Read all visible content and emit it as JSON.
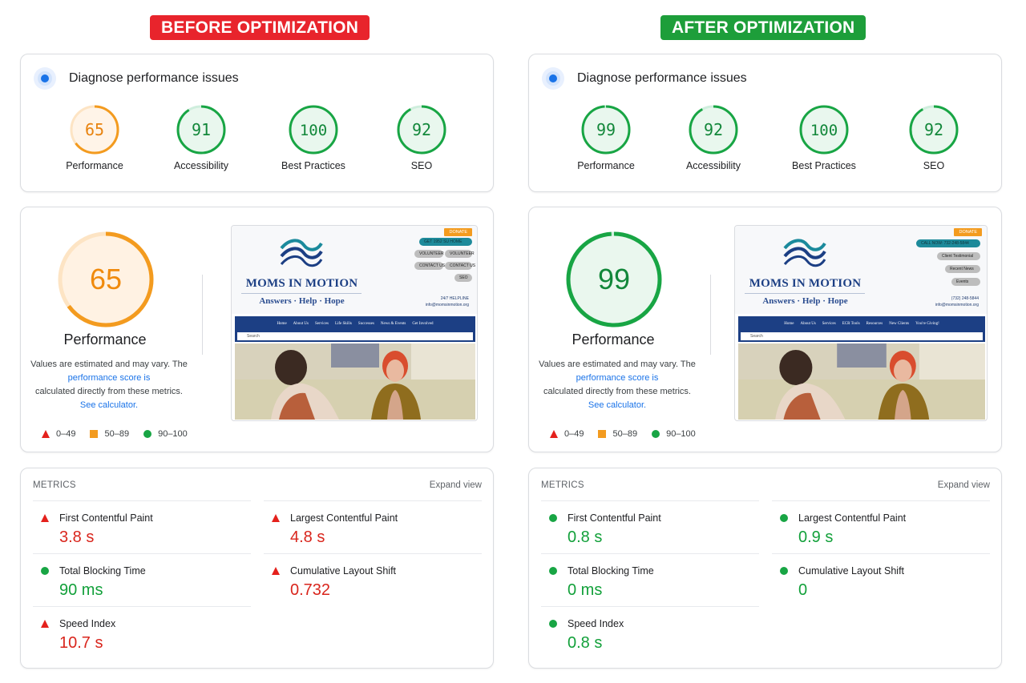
{
  "colors": {
    "fail": "#e4211c",
    "average": "#f39b1f",
    "pass": "#18a544",
    "link": "#1a73e8",
    "before_badge": "#e8242c",
    "after_badge": "#1d9e3a"
  },
  "before": {
    "badge": "BEFORE OPTIMIZATION",
    "diagnose_title": "Diagnose performance issues",
    "scores": [
      {
        "label": "Performance",
        "value": "65",
        "rating": "average"
      },
      {
        "label": "Accessibility",
        "value": "91",
        "rating": "pass"
      },
      {
        "label": "Best Practices",
        "value": "100",
        "rating": "pass"
      },
      {
        "label": "SEO",
        "value": "92",
        "rating": "pass"
      }
    ],
    "perf_score": "65",
    "perf_title": "Performance",
    "perf_desc_1": "Values are estimated and may vary. The",
    "perf_desc_link": "performance score is",
    "perf_desc_2": "calculated directly from these metrics.",
    "perf_calc_link": "See calculator.",
    "legend": [
      "0–49",
      "50–89",
      "90–100"
    ],
    "metrics_label": "METRICS",
    "expand_label": "Expand view",
    "metrics": [
      {
        "name": "First Contentful Paint",
        "value": "3.8 s",
        "rating": "fail"
      },
      {
        "name": "Total Blocking Time",
        "value": "90 ms",
        "rating": "pass"
      },
      {
        "name": "Speed Index",
        "value": "10.7 s",
        "rating": "fail"
      },
      {
        "name": "Largest Contentful Paint",
        "value": "4.8 s",
        "rating": "fail"
      },
      {
        "name": "Cumulative Layout Shift",
        "value": "0.732",
        "rating": "fail"
      }
    ],
    "site": {
      "logo": "MOMS IN MOTION",
      "tagline": "Answers · Help · Hope",
      "donate": "DONATE",
      "pills": [
        "GET 1952 SU HOME",
        "VOLUNTEER",
        "VOLUNTEER",
        "CONTACT US",
        "CONTACT US",
        "SEO"
      ],
      "phone": "24/7 HELPLINE",
      "email": "info@momsinmotion.org",
      "nav": [
        "Home",
        "About Us",
        "Services",
        "Life Skills",
        "Successes",
        "News & Events",
        "Get Involved"
      ],
      "search": "Search"
    }
  },
  "after": {
    "badge": "AFTER OPTIMIZATION",
    "diagnose_title": "Diagnose performance issues",
    "scores": [
      {
        "label": "Performance",
        "value": "99",
        "rating": "pass"
      },
      {
        "label": "Accessibility",
        "value": "92",
        "rating": "pass"
      },
      {
        "label": "Best Practices",
        "value": "100",
        "rating": "pass"
      },
      {
        "label": "SEO",
        "value": "92",
        "rating": "pass"
      }
    ],
    "perf_score": "99",
    "perf_title": "Performance",
    "perf_desc_1": "Values are estimated and may vary. The",
    "perf_desc_link": "performance score is",
    "perf_desc_2": "calculated directly from these metrics.",
    "perf_calc_link": "See calculator.",
    "legend": [
      "0–49",
      "50–89",
      "90–100"
    ],
    "metrics_label": "METRICS",
    "expand_label": "Expand view",
    "metrics": [
      {
        "name": "First Contentful Paint",
        "value": "0.8 s",
        "rating": "pass"
      },
      {
        "name": "Total Blocking Time",
        "value": "0 ms",
        "rating": "pass"
      },
      {
        "name": "Speed Index",
        "value": "0.8 s",
        "rating": "pass"
      },
      {
        "name": "Largest Contentful Paint",
        "value": "0.9 s",
        "rating": "pass"
      },
      {
        "name": "Cumulative Layout Shift",
        "value": "0",
        "rating": "pass"
      }
    ],
    "site": {
      "logo": "MOMS IN MOTION",
      "tagline": "Answers · Help · Hope",
      "donate": "DONATE",
      "pills": [
        "CALL NOW: 732-248-5844",
        "Client Testimonial",
        "Recent News",
        "Events"
      ],
      "phone": "(732) 248-5844",
      "email": "info@momsinmotion.org",
      "nav": [
        "Home",
        "About Us",
        "Services",
        "ECR Tools",
        "Resources",
        "New Clients",
        "You're Giving!"
      ],
      "search": "Search"
    }
  }
}
